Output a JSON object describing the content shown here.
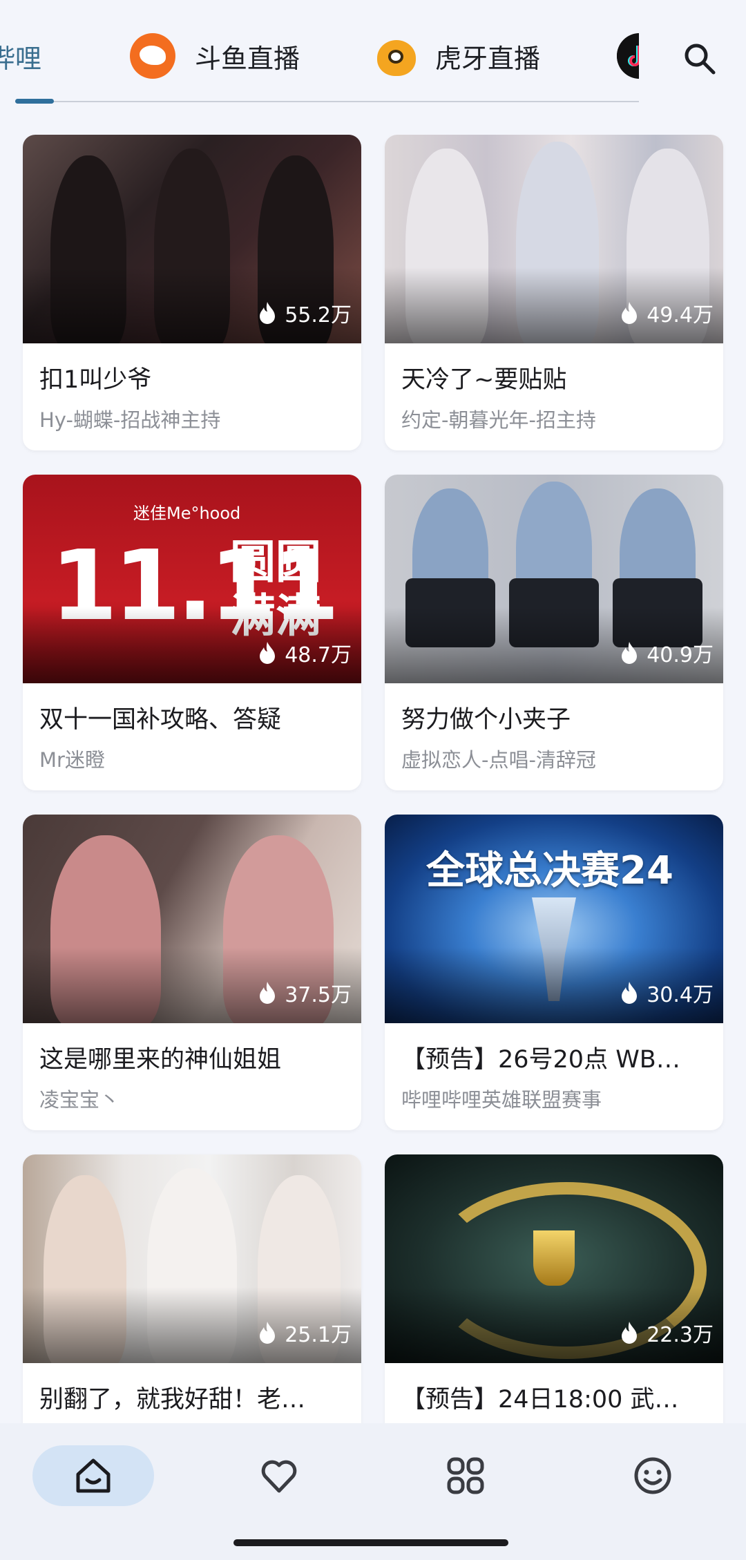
{
  "tabs": [
    {
      "label": "哔哩",
      "icon": "",
      "active": true
    },
    {
      "label": "斗鱼直播",
      "icon": "douyu-logo-icon",
      "active": false
    },
    {
      "label": "虎牙直播",
      "icon": "huya-logo-icon",
      "active": false
    },
    {
      "label": "",
      "icon": "douyin-logo-icon",
      "active": false
    }
  ],
  "search": {
    "icon": "search-icon"
  },
  "cards": [
    {
      "title": "扣1叫少爷",
      "streamer": "Hy-蝴蝶-招战神主持",
      "viewers": "55.2万"
    },
    {
      "title": "天冷了~要贴贴",
      "streamer": "约定-朝暮光年-招主持",
      "viewers": "49.4万"
    },
    {
      "title": "双十一国补攻略、答疑",
      "streamer": "Mr迷瞪",
      "viewers": "48.7万"
    },
    {
      "title": "努力做个小夹子",
      "streamer": "虚拟恋人-点唱-清辞冠",
      "viewers": "40.9万"
    },
    {
      "title": "这是哪里来的神仙姐姐",
      "streamer": "凌宝宝丶",
      "viewers": "37.5万"
    },
    {
      "title": "【预告】26号20点 WB…",
      "streamer": "哔哩哔哩英雄联盟赛事",
      "viewers": "30.4万"
    },
    {
      "title": "别翻了，就我好甜！老…",
      "streamer": "",
      "viewers": "25.1万"
    },
    {
      "title": "【预告】24日18:00 武…",
      "streamer": "",
      "viewers": "22.3万"
    }
  ],
  "thumb_text": {
    "promo_brand": "迷佳Me°hood",
    "promo_big": "11.11",
    "promo_cn_1": "圆圆",
    "promo_cn_2": "满满",
    "lol_title": "全球总决赛24"
  },
  "nav": [
    {
      "icon": "home-icon",
      "active": true
    },
    {
      "icon": "heart-icon",
      "active": false
    },
    {
      "icon": "apps-icon",
      "active": false
    },
    {
      "icon": "smiley-icon",
      "active": false
    }
  ],
  "colors": {
    "accent": "#2f6f9c",
    "nav_active_bg": "#d3e3f5",
    "background": "#f3f5fb"
  }
}
